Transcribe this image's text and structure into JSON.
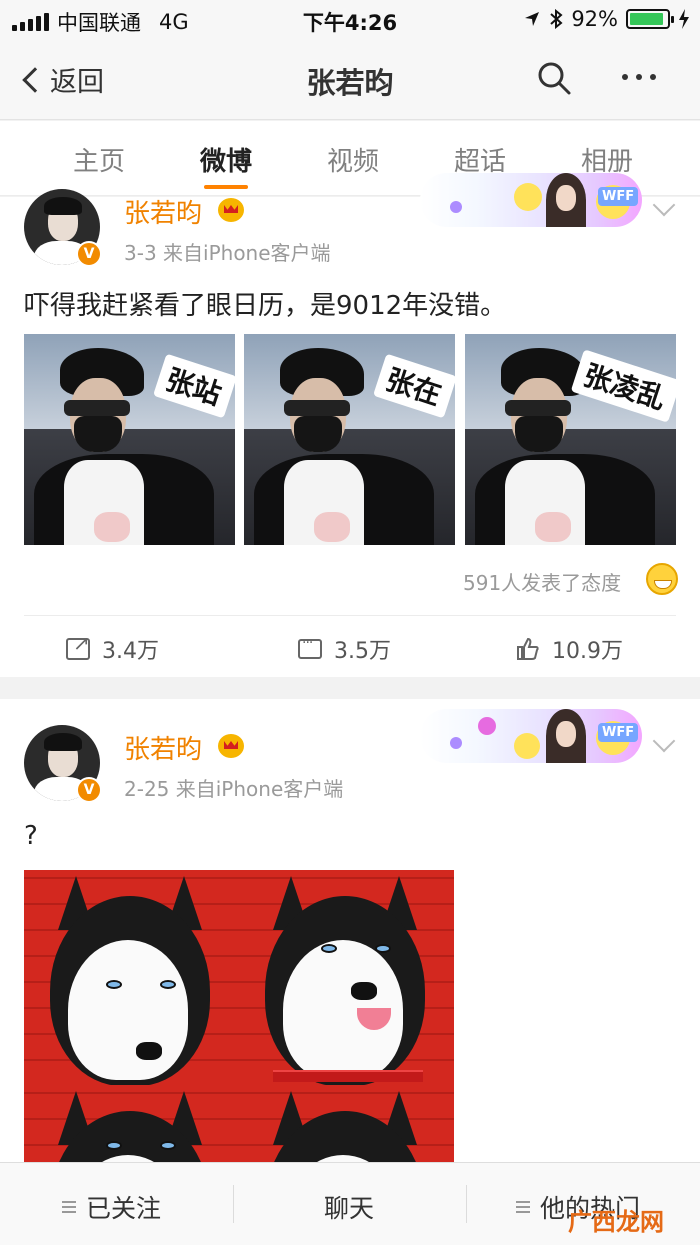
{
  "status_bar": {
    "carrier": "中国联通",
    "network": "4G",
    "time": "下午4:26",
    "battery_pct": "92%",
    "battery_level": 0.92
  },
  "navbar": {
    "back_label": "返回",
    "title": "张若昀"
  },
  "tabs": [
    "主页",
    "微博",
    "视频",
    "超话",
    "相册"
  ],
  "active_tab": "微博",
  "posts": [
    {
      "author": "张若昀",
      "verified_badge": "V",
      "meta": "3-3  来自iPhone客户端",
      "text": "吓得我赶紧看了眼日历，是9012年没错。",
      "image_captions": [
        "张站",
        "张在",
        "张凌乱"
      ],
      "reaction_text": "591人发表了态度",
      "share_count": "3.4万",
      "comment_count": "3.5万",
      "like_count": "10.9万"
    },
    {
      "author": "张若昀",
      "verified_badge": "V",
      "meta": "2-25  来自iPhone客户端",
      "text": "?"
    }
  ],
  "banner_tag": "WFF",
  "bottom_bar": {
    "following": "已关注",
    "chat": "聊天",
    "popular": "他的热门"
  },
  "watermark": "广西龙网",
  "colors": {
    "accent": "#ff8200",
    "username": "#f08200",
    "battery": "#35c759"
  }
}
